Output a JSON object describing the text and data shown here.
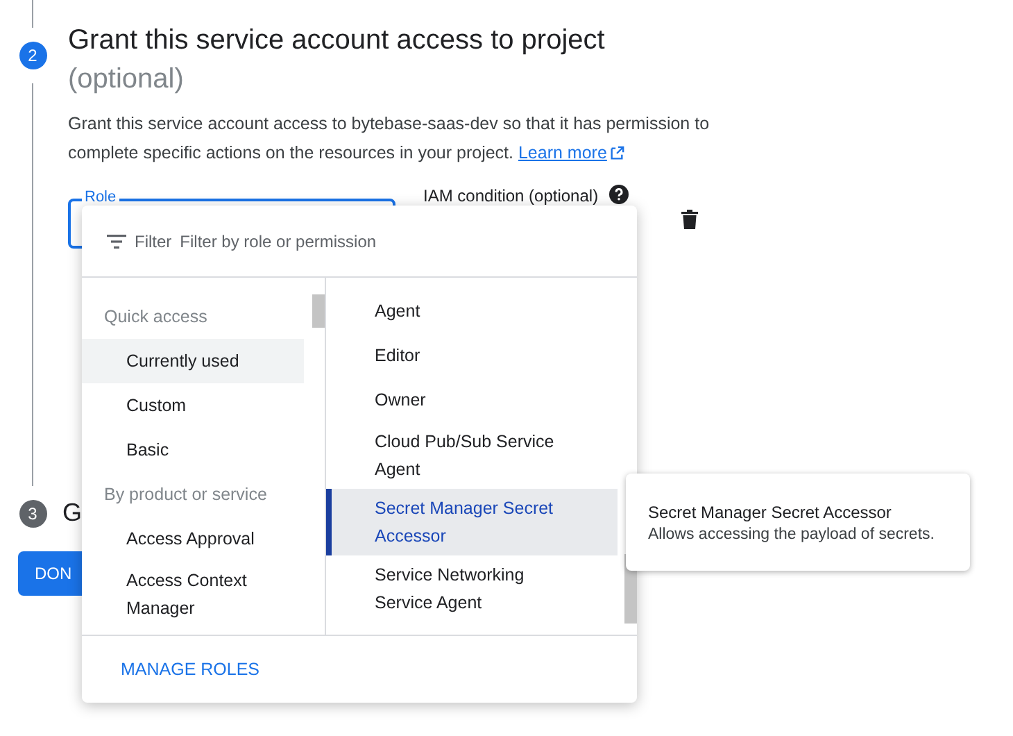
{
  "step2": {
    "number": "2",
    "title": "Grant this service account access to project",
    "subtitle": "(optional)",
    "description": "Grant this service account access to bytebase-saas-dev so that it has permission to complete specific actions on the resources in your project.",
    "link": "Learn more",
    "role_field": {
      "label": "Role",
      "focused": true
    },
    "iam_condition": "IAM condition (optional)"
  },
  "role_menu": {
    "filter_label": "Filter",
    "filter_placeholder": "Filter by role or permission",
    "categories": [
      {
        "kind": "header",
        "label": "Quick access"
      },
      {
        "kind": "item",
        "label": "Currently used",
        "highlighted": true
      },
      {
        "kind": "item",
        "label": "Custom",
        "highlighted": false
      },
      {
        "kind": "item",
        "label": "Basic",
        "highlighted": false
      },
      {
        "kind": "header",
        "label": "By product or service"
      },
      {
        "kind": "item",
        "label": "Access Approval",
        "highlighted": false
      },
      {
        "kind": "item",
        "label": "Access Context Manager",
        "highlighted": false
      }
    ],
    "roles": [
      {
        "label": "Agent",
        "selected": false
      },
      {
        "label": "Editor",
        "selected": false
      },
      {
        "label": "Owner",
        "selected": false
      },
      {
        "label": "Cloud Pub/Sub Service Agent",
        "selected": false
      },
      {
        "label": "Secret Manager Secret Accessor",
        "selected": true
      },
      {
        "label": "Service Networking Service Agent",
        "selected": false
      }
    ],
    "footer_button": "MANAGE ROLES"
  },
  "tooltip": {
    "title": "Secret Manager Secret Accessor",
    "description": "Allows accessing the payload of secrets."
  },
  "step3": {
    "number": "3",
    "title": "G"
  },
  "done_button": "DON"
}
